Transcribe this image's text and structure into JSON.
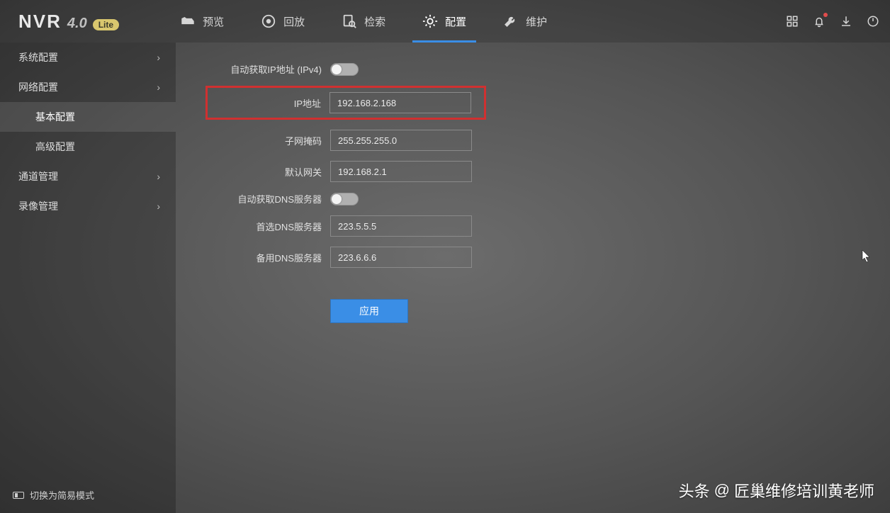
{
  "brand": {
    "name": "NVR",
    "version": "4.0",
    "badge": "Lite"
  },
  "topnav": [
    {
      "label": "预览"
    },
    {
      "label": "回放"
    },
    {
      "label": "检索"
    },
    {
      "label": "配置"
    },
    {
      "label": "维护"
    }
  ],
  "sidebar": {
    "items": [
      {
        "label": "系统配置"
      },
      {
        "label": "网络配置"
      },
      {
        "label": "通道管理"
      },
      {
        "label": "录像管理"
      }
    ],
    "subitems": [
      {
        "label": "基本配置"
      },
      {
        "label": "高级配置"
      }
    ],
    "bottom": "切换为简易模式"
  },
  "form": {
    "auto_ipv4_label": "自动获取IP地址 (IPv4)",
    "ip_label": "IP地址",
    "ip_value": "192.168.2.168",
    "mask_label": "子网掩码",
    "mask_value": "255.255.255.0",
    "gw_label": "默认网关",
    "gw_value": "192.168.2.1",
    "auto_dns_label": "自动获取DNS服务器",
    "dns1_label": "首选DNS服务器",
    "dns1_value": "223.5.5.5",
    "dns2_label": "备用DNS服务器",
    "dns2_value": "223.6.6.6",
    "apply": "应用"
  },
  "watermark": {
    "head": "头条",
    "at": "@",
    "name": "匠巢维修培训黄老师"
  }
}
